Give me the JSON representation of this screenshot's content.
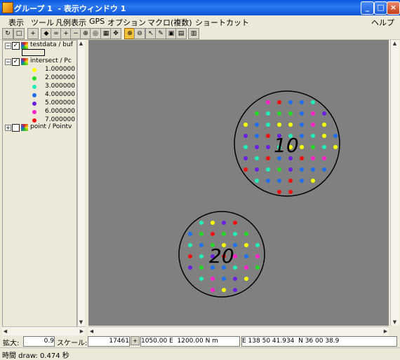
{
  "window": {
    "title": "グループ 1  - 表示ウィンドウ 1",
    "buttons": [
      "_",
      "□",
      "×"
    ]
  },
  "menu": [
    "表示",
    "ツール",
    "凡例表示",
    "GPS",
    "オプション",
    "マクロ(複数)",
    "ショートカット",
    "ヘルプ"
  ],
  "legend": {
    "layers": [
      {
        "name": "testdata / buf",
        "checked": true
      },
      {
        "name": "intersect / Pc",
        "checked": true
      },
      {
        "name": "point / Pointv",
        "checked": false
      }
    ],
    "classes": [
      {
        "label": "1.000000",
        "color": "#ffff00"
      },
      {
        "label": "2.000000",
        "color": "#22dd22"
      },
      {
        "label": "3.000000",
        "color": "#22eebb"
      },
      {
        "label": "4.000000",
        "color": "#1e6ef0"
      },
      {
        "label": "5.000000",
        "color": "#6a1ee0"
      },
      {
        "label": "6.000000",
        "color": "#ff22cc"
      },
      {
        "label": "7.000000",
        "color": "#ee1111"
      }
    ]
  },
  "map": {
    "labels": [
      "10",
      "20"
    ],
    "background": "#808080"
  },
  "status": {
    "zoom_label": "拡大:",
    "zoom_value": "0.9",
    "scale_label": "スケール:",
    "scale_value": "17461",
    "coords": "1050.00 E  1200.00 N m",
    "latlon": "E 138 50 41.934  N 36 00 38.9"
  },
  "footer": {
    "time": "時間 draw: 0.474 秒"
  }
}
